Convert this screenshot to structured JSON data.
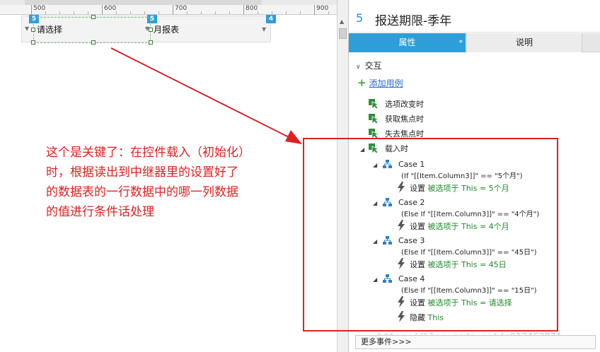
{
  "ruler": {
    "ticks": [
      "500",
      "600",
      "700",
      "800",
      "900"
    ]
  },
  "canvas": {
    "markers": [
      "5",
      "5",
      "4"
    ],
    "dropdown1_text": "请选择",
    "dropdown2_text": "月报表",
    "annotation_lines": [
      "这个是关键了：在控件载入（初始化）",
      "时，根据读出到中继器里的设置好了",
      "的数据表的一行数据中的哪一列数据",
      "的值进行条件话处理"
    ]
  },
  "panel": {
    "number": "5",
    "title": "报送期限-季年",
    "tabs": {
      "properties": "属性",
      "properties_marker": "*",
      "notes": "说明"
    },
    "section": "交互",
    "add_case": "添加用例",
    "events": [
      "选项改变时",
      "获取焦点时",
      "失去焦点时",
      "载入时"
    ],
    "cases": [
      {
        "label": "Case 1",
        "condition": "(If \"[[Item.Column3]]\" == \"5个月\")",
        "actions": [
          {
            "verb": "设置",
            "target": "被选项于 This = 5个月"
          }
        ]
      },
      {
        "label": "Case 2",
        "condition": "(Else If \"[[Item.Column3]]\" == \"4个月\")",
        "actions": [
          {
            "verb": "设置",
            "target": "被选项于 This = 4个月"
          }
        ]
      },
      {
        "label": "Case 3",
        "condition": "(Else If \"[[Item.Column3]]\" == \"45日\")",
        "actions": [
          {
            "verb": "设置",
            "target": "被选项于 This = 45日"
          }
        ]
      },
      {
        "label": "Case 4",
        "condition": "(Else If \"[[Item.Column3]]\" == \"15日\")",
        "actions": [
          {
            "verb": "设置",
            "target": "被选项于 This = 请选择"
          },
          {
            "verb": "隐藏",
            "target": "This"
          }
        ]
      }
    ],
    "more_events": "更多事件>>>",
    "watermark": "https://blog.csdn.net/u012463871"
  },
  "colors": {
    "accent": "#2e9ed8",
    "annotation": "#e02020",
    "action_target": "#1f8a2a",
    "link": "#2a6ac8"
  },
  "icons": [
    "cursor-event-icon",
    "case-flow-icon",
    "lightning-action-icon",
    "plus-icon",
    "expand-triangle-icon",
    "dropdown-arrow-icon"
  ]
}
